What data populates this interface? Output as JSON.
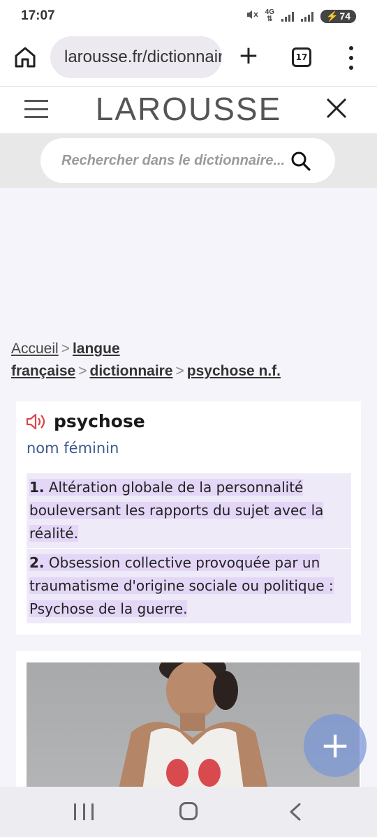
{
  "status_bar": {
    "time": "17:07",
    "network": "4G",
    "battery": "74"
  },
  "browser": {
    "url": "larousse.fr/dictionnaire",
    "tab_count": "17"
  },
  "site": {
    "logo": "LAROUSSE",
    "search_placeholder": "Rechercher dans le dictionnaire..."
  },
  "breadcrumb": [
    {
      "label": "Accueil"
    },
    {
      "label": "langue française"
    },
    {
      "label": "dictionnaire"
    },
    {
      "label": "psychose n.f."
    }
  ],
  "entry": {
    "headword": "psychose",
    "part_of_speech": "nom féminin",
    "definitions": [
      {
        "num": "1.",
        "text": "Altération globale de la personnalité bouleversant les rapports du sujet avec la réalité."
      },
      {
        "num": "2.",
        "text": "Obsession collective provoquée par un traumatisme d'origine sociale ou politique : Psychose de la guerre."
      }
    ]
  },
  "colors": {
    "accent_speaker": "#d9464a",
    "pos_blue": "#3b5a8c",
    "definition_highlight": "#e4d6f6",
    "fab": "#7896d7"
  },
  "icons": [
    "home-icon",
    "site-info-icon",
    "plus-icon",
    "tabs-icon",
    "more-vert-icon",
    "hamburger-icon",
    "close-icon",
    "search-icon",
    "speaker-icon",
    "add-icon"
  ]
}
